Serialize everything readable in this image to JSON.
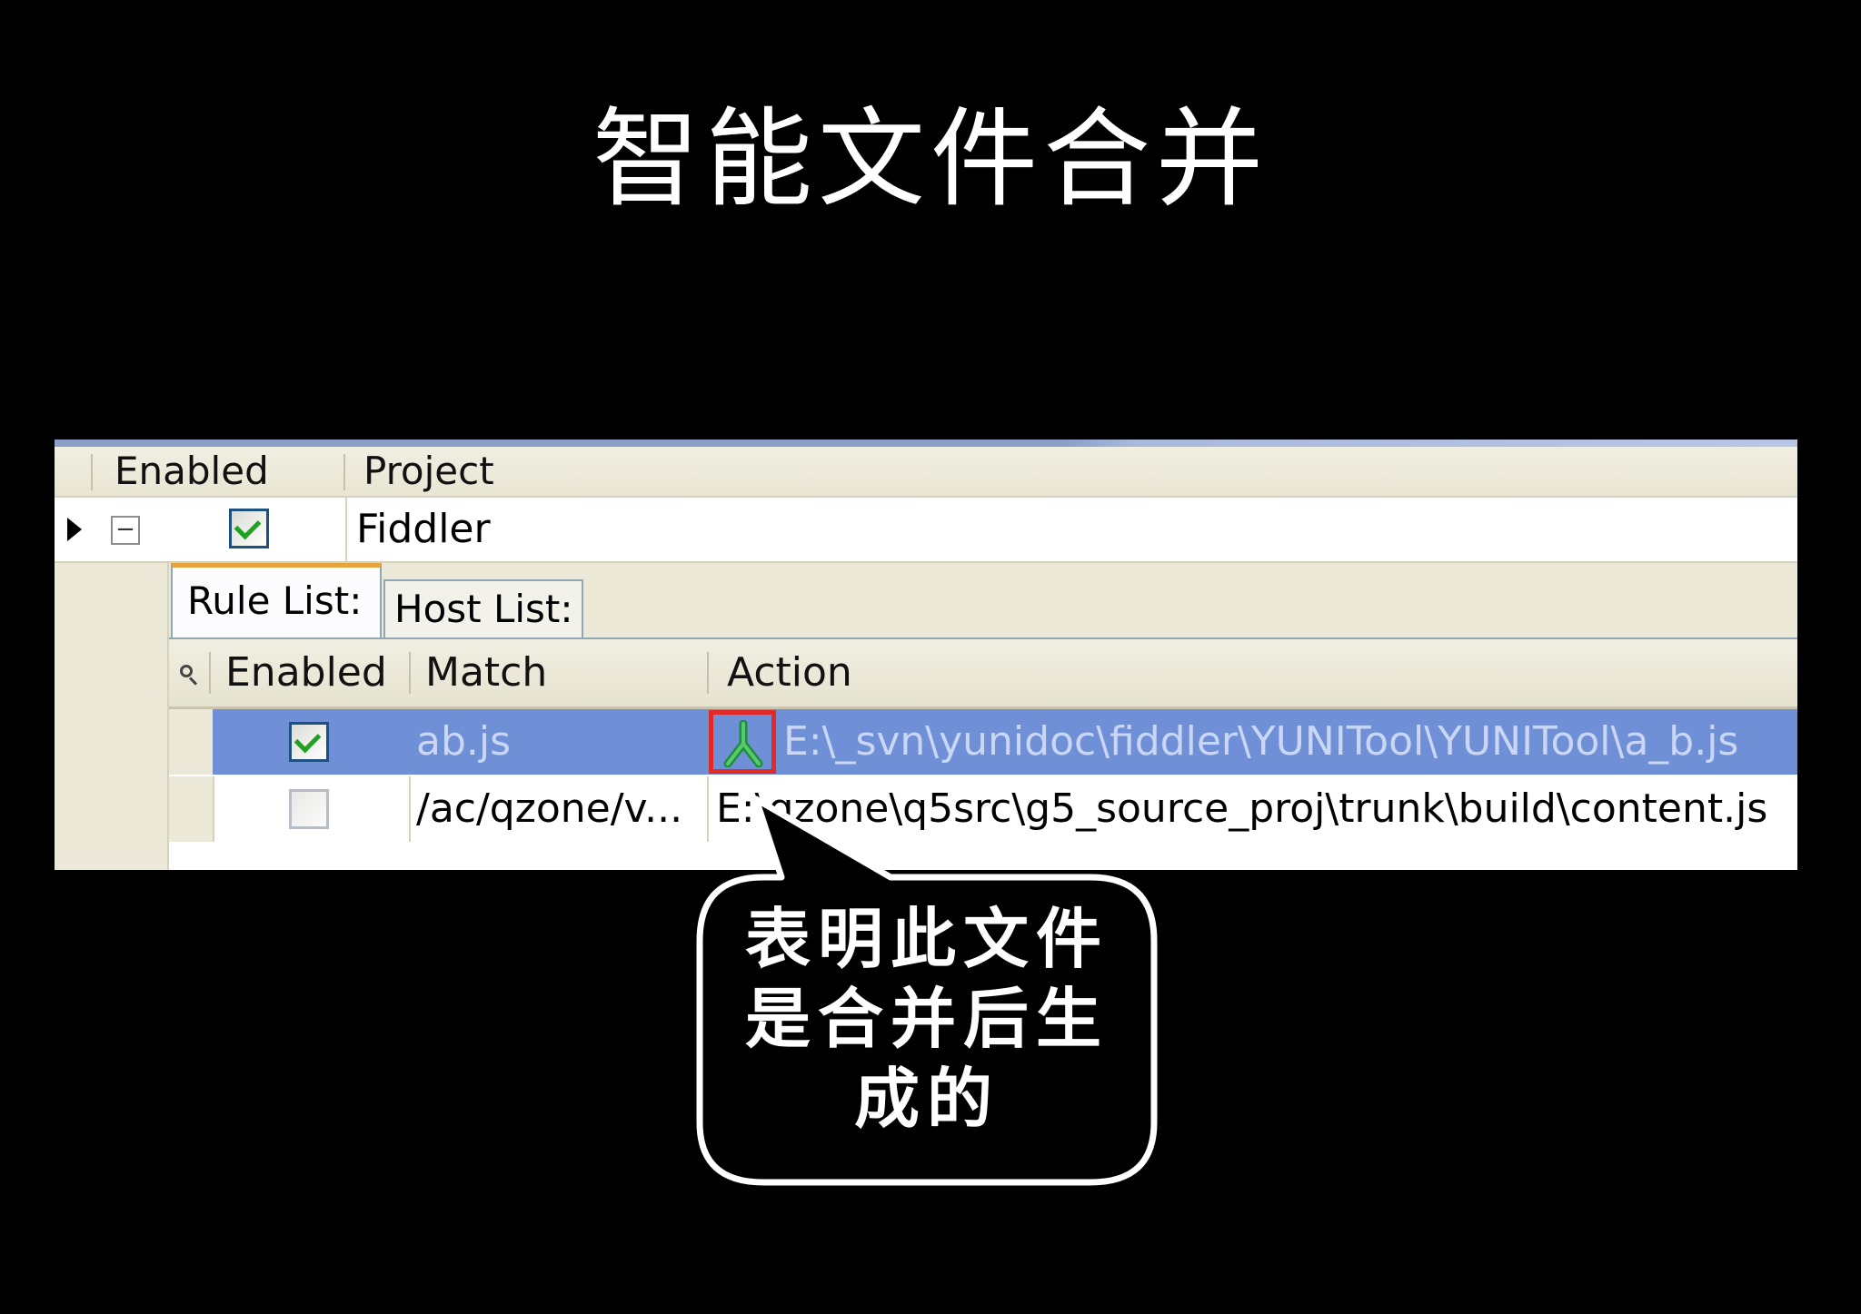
{
  "slide": {
    "title": "智能文件合并"
  },
  "outer_grid": {
    "columns": [
      "Enabled",
      "Project"
    ],
    "row": {
      "enabled": true,
      "project": "Fiddler"
    }
  },
  "tabs": [
    {
      "label": "Rule List:",
      "active": true
    },
    {
      "label": "Host List:",
      "active": false
    }
  ],
  "inner_grid": {
    "columns": [
      "Enabled",
      "Match",
      "Action"
    ],
    "rows": [
      {
        "enabled": true,
        "match": "ab.js",
        "action": "E:\\_svn\\yunidoc\\fiddler\\YUNITool\\YUNITool\\a_b.js",
        "selected": true,
        "icon": "merge-icon"
      },
      {
        "enabled": false,
        "match": "/ac/qzone/v...",
        "action": "E:\\qzone\\q5src\\g5_source_proj\\trunk\\build\\content.js",
        "selected": false
      }
    ]
  },
  "callout": {
    "lines": [
      "表明此文件",
      "是合并后生",
      "成的"
    ]
  },
  "colors": {
    "selection": "#6f8fd6",
    "highlight_border": "#e32a2a",
    "check_tick": "#21a121",
    "tab_accent": "#e6a43b"
  }
}
